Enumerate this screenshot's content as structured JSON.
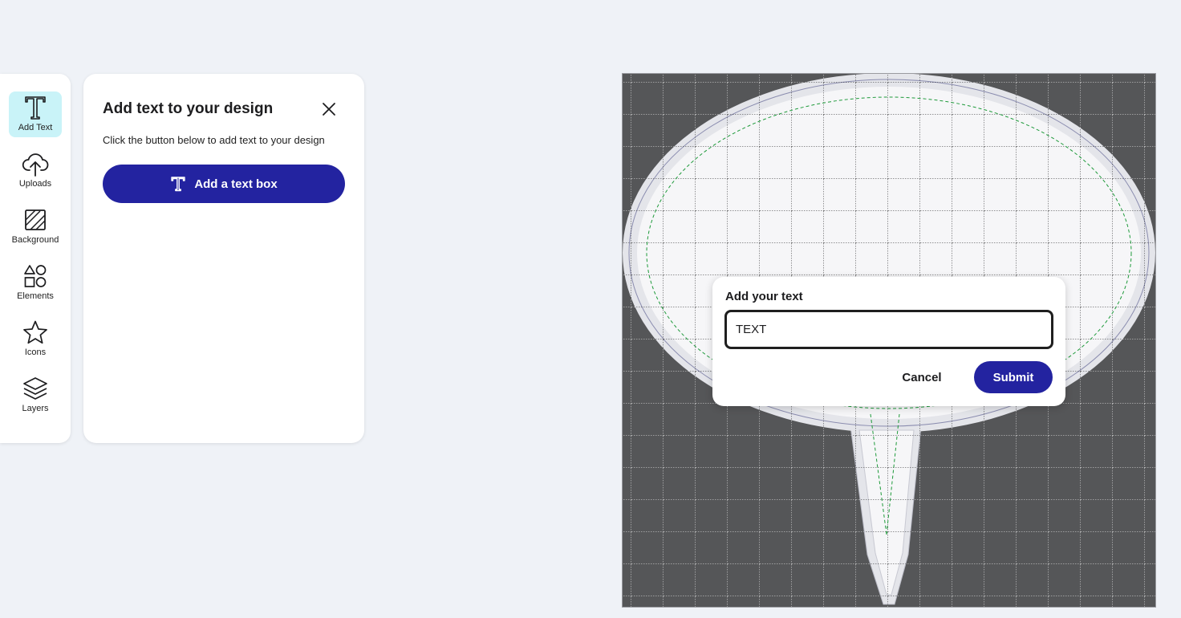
{
  "rail": {
    "items": [
      {
        "label": "Add Text",
        "icon": "text-icon",
        "active": true
      },
      {
        "label": "Uploads",
        "icon": "cloud-upload-icon",
        "active": false
      },
      {
        "label": "Background",
        "icon": "background-icon",
        "active": false
      },
      {
        "label": "Elements",
        "icon": "shapes-icon",
        "active": false
      },
      {
        "label": "Icons",
        "icon": "star-icon",
        "active": false
      },
      {
        "label": "Layers",
        "icon": "layers-icon",
        "active": false
      }
    ]
  },
  "panel": {
    "title": "Add text to your design",
    "description": "Click the button below to add text to your design",
    "add_button_label": "Add a text box",
    "close_icon": "close-icon"
  },
  "canvas": {
    "background_color": "#555658",
    "shape": "speech-bubble-on-stake"
  },
  "dialog": {
    "title": "Add your text",
    "input_value": "TEXT",
    "cancel_label": "Cancel",
    "submit_label": "Submit"
  },
  "colors": {
    "page_bg": "#eff2f7",
    "primary": "#2323a0",
    "active_tab": "#c9f3f8",
    "safe_zone_line": "#1e9a3a"
  }
}
